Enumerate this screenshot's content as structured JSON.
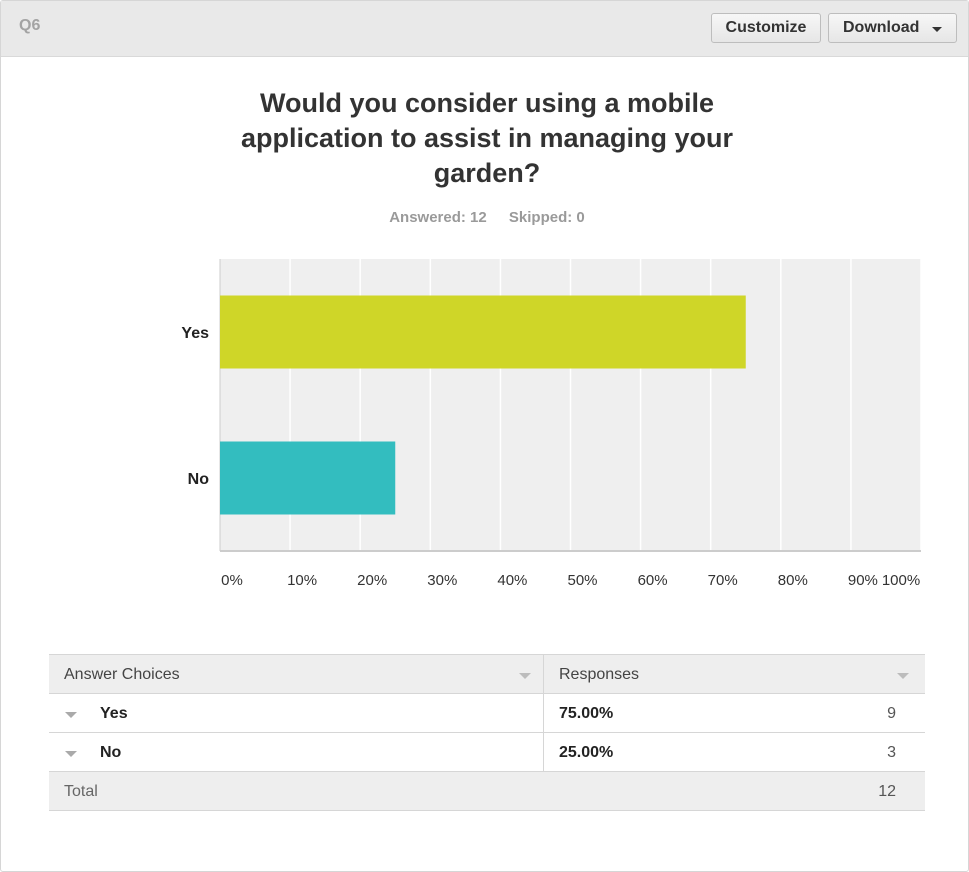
{
  "header": {
    "question_number": "Q6",
    "customize_label": "Customize",
    "download_label": "Download"
  },
  "question": {
    "title": "Would you consider using a mobile application to assist in managing your garden?",
    "answered": "Answered: 12",
    "skipped": "Skipped: 0"
  },
  "chart_data": {
    "type": "bar",
    "orientation": "horizontal",
    "categories": [
      "Yes",
      "No"
    ],
    "values": [
      75,
      25
    ],
    "colors": [
      "#cfd628",
      "#33bdbf"
    ],
    "xlim": [
      0,
      100
    ],
    "xticks": [
      "0%",
      "10%",
      "20%",
      "30%",
      "40%",
      "50%",
      "60%",
      "70%",
      "80%",
      "90%",
      "100%"
    ],
    "grid": true,
    "background": "#efefef"
  },
  "table": {
    "headers": [
      "Answer Choices",
      "Responses"
    ],
    "rows": [
      {
        "choice": "Yes",
        "percent": "75.00%",
        "count": "9"
      },
      {
        "choice": "No",
        "percent": "25.00%",
        "count": "3"
      }
    ],
    "total_label": "Total",
    "total_value": "12"
  }
}
